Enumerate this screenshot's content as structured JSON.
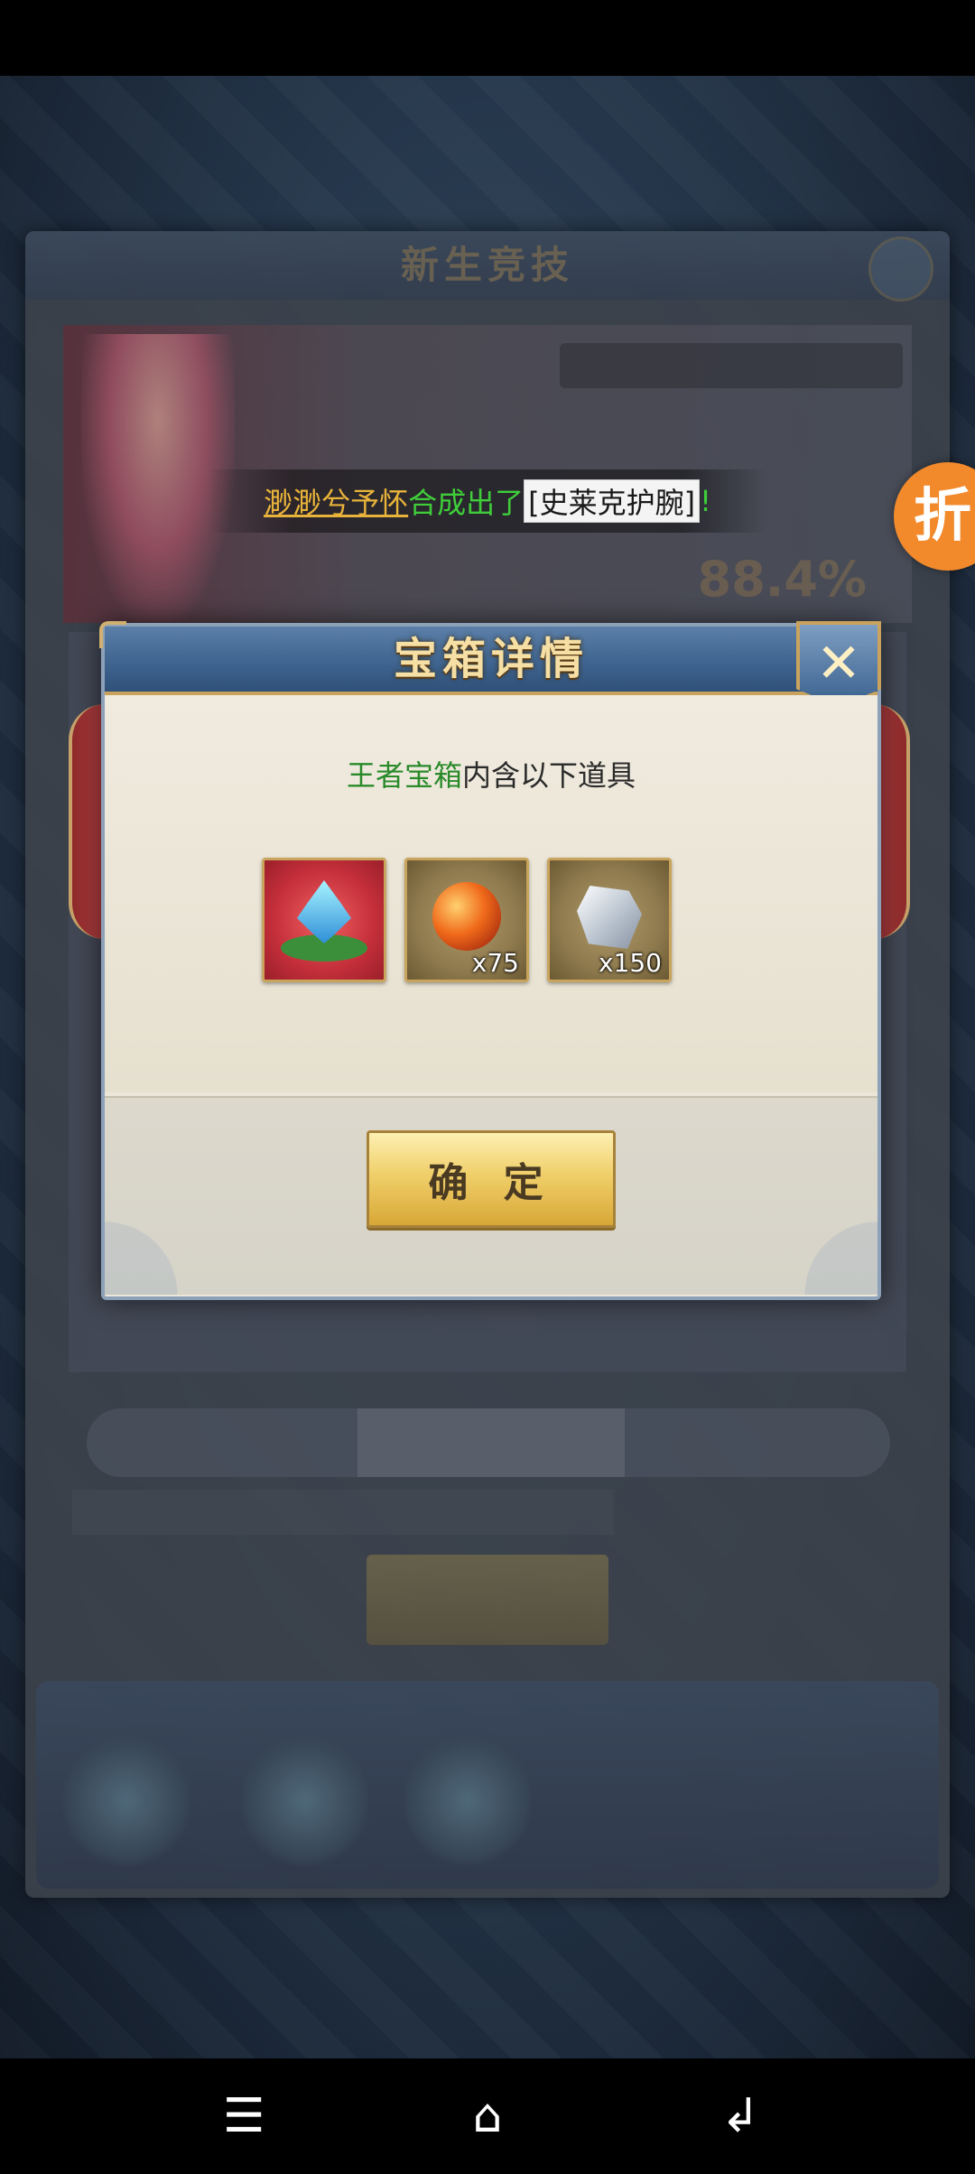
{
  "marquee": {
    "player_name": "渺渺兮予怀",
    "action_text": "合成出了",
    "item_name": "[史莱克护腕]",
    "suffix": "!"
  },
  "background": {
    "panel_title": "新生竞技",
    "percent": "88.4%"
  },
  "discount_badge": "折",
  "dialog": {
    "title": "宝箱详情",
    "close_symbol": "✕",
    "description_highlight": "王者宝箱",
    "description_rest": "内含以下道具",
    "items": [
      {
        "icon": "blue-lotus-gem-icon",
        "count": ""
      },
      {
        "icon": "red-orb-icon",
        "count": "x75"
      },
      {
        "icon": "silver-ore-icon",
        "count": "x150"
      }
    ],
    "confirm_label": "确 定"
  },
  "navbar": {
    "menu_symbol": "☰",
    "home_symbol": "⌂",
    "back_symbol": "↲"
  }
}
